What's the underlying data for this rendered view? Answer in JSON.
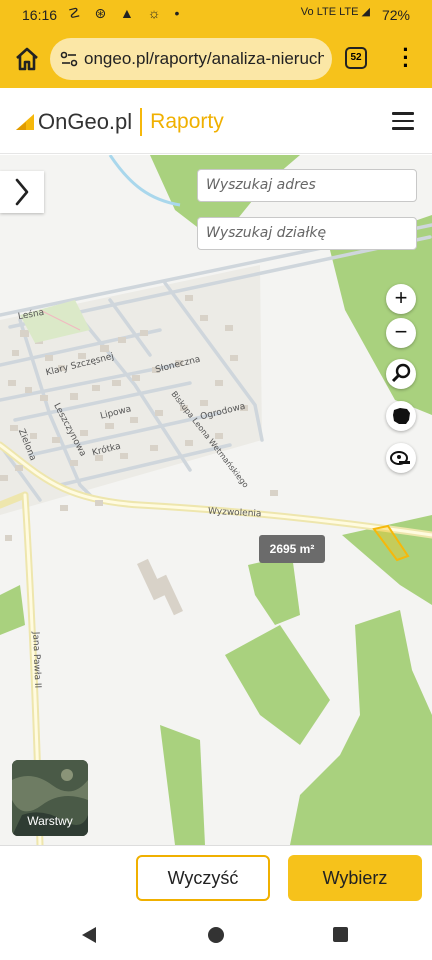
{
  "status_bar": {
    "time": "16:16",
    "left_icons": "☡ ⊛ ▲ ☼ •",
    "network": "Vo LTE  LTE ◢",
    "battery": "72%"
  },
  "browser": {
    "url": "ongeo.pl/raporty/analiza-nieruch",
    "tab_count": "52"
  },
  "header": {
    "brand": "OnGeo.pl",
    "section": "Raporty"
  },
  "search": {
    "address_placeholder": "Wyszukaj adres",
    "parcel_placeholder": "Wyszukaj działkę"
  },
  "map": {
    "area_label": "2695 m²",
    "layers_label": "Warstwy",
    "street_labels": {
      "lesna": "Leśna",
      "klary": "Klary Szczęsnej",
      "sloneczna": "Słoneczna",
      "leszczynowa": "Leszczynowa",
      "lipowa": "Lipowa",
      "biskupa": "Biskupa Leona Wetmańskiego",
      "ogrodowa": "Ogrodowa",
      "zielona": "Zielona",
      "krotka": "Krótka",
      "wyzwolenia": "Wyzwolenia",
      "jana_pawla": "Jana Pawła II"
    },
    "colors": {
      "forest": "#a9d17e",
      "road_main": "#f2ecb8",
      "parcel": "#f6c21b"
    }
  },
  "actions": {
    "clear": "Wyczyść",
    "select": "Wybierz"
  }
}
